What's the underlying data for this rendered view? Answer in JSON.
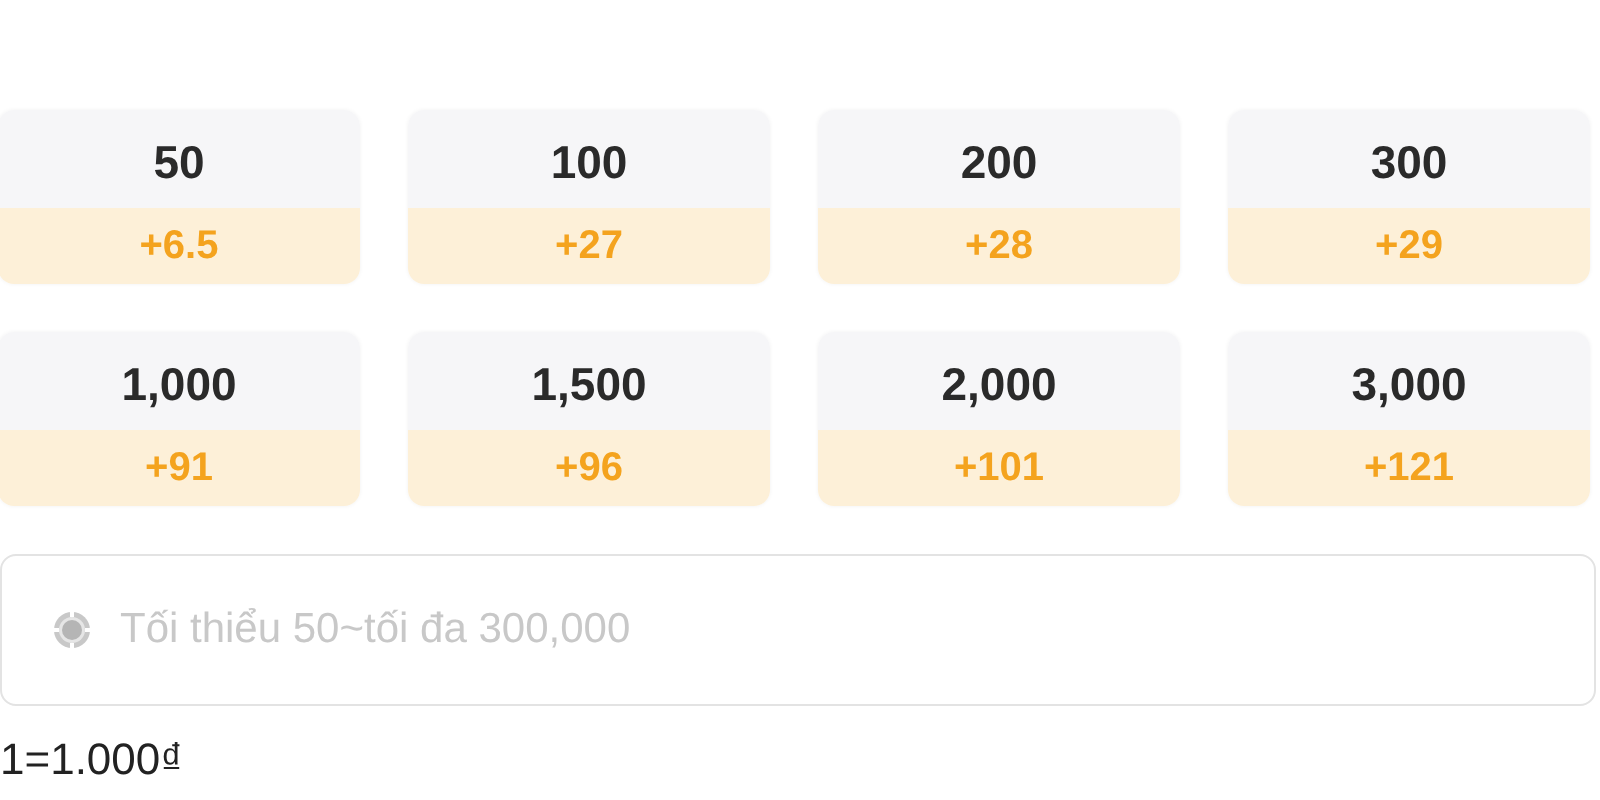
{
  "packages": [
    {
      "amount": "50",
      "bonus": "+6.5"
    },
    {
      "amount": "100",
      "bonus": "+27"
    },
    {
      "amount": "200",
      "bonus": "+28"
    },
    {
      "amount": "300",
      "bonus": "+29"
    },
    {
      "amount": "1,000",
      "bonus": "+91"
    },
    {
      "amount": "1,500",
      "bonus": "+96"
    },
    {
      "amount": "2,000",
      "bonus": "+101"
    },
    {
      "amount": "3,000",
      "bonus": "+121"
    }
  ],
  "amount_field": {
    "placeholder": "Tối thiểu 50~tối đa 300,000"
  },
  "rate_note": "1=1.000₫"
}
